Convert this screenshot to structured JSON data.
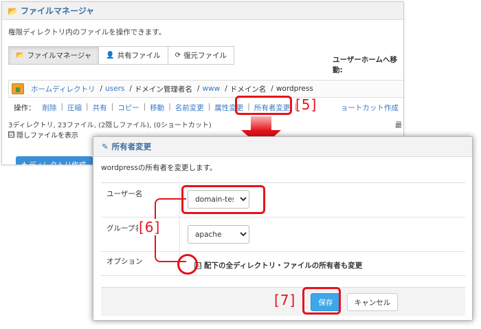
{
  "file_manager": {
    "title": "ファイルマネージャ",
    "description": "権限ディレクトリ内のファイルを操作できます。",
    "tabs": [
      {
        "label": "ファイルマネージャ",
        "icon": "folder-open-icon",
        "active": true
      },
      {
        "label": "共有ファイル",
        "icon": "user-icon",
        "active": false
      },
      {
        "label": "復元ファイル",
        "icon": "refresh-icon",
        "active": false
      }
    ],
    "home_move_label": "ユーザーホームへ移動:",
    "breadcrumb": {
      "home": "ホームディレクトリ",
      "sep": "/",
      "users": "users",
      "domain_admin": "ドメイン管理者名",
      "www": "www",
      "domain": "ドメイン名",
      "wordpress": "wordpress"
    },
    "ops_label": "操作：",
    "ops": [
      "削除",
      "圧縮",
      "共有",
      "コピー",
      "移動",
      "名前変更",
      "属性変更",
      "所有者変更",
      "ョートカット作成"
    ],
    "counts": "3ディレクトリ, 23ファイル, (2隠しファイル), (0ショートカット)",
    "right_cut": "最",
    "hidden_files_label": "隠しファイルを表示",
    "mkdir_label": "ディレクトリ作成"
  },
  "dialog": {
    "title": "所有者変更",
    "message": "wordpressの所有者を変更します。",
    "user_label": "ユーザー名",
    "user_value": "domain-test",
    "group_label": "グループ名",
    "group_value": "apache",
    "option_label": "オプション",
    "option_checkbox": "配下の全ディレクトリ・ファイルの所有者も変更",
    "save_label": "保存",
    "cancel_label": "キャンセル"
  },
  "annotations": {
    "step5": "[5]",
    "step6": "[6]",
    "step7": "[7]",
    "color": "#e5121b"
  },
  "checkmark": "☑"
}
